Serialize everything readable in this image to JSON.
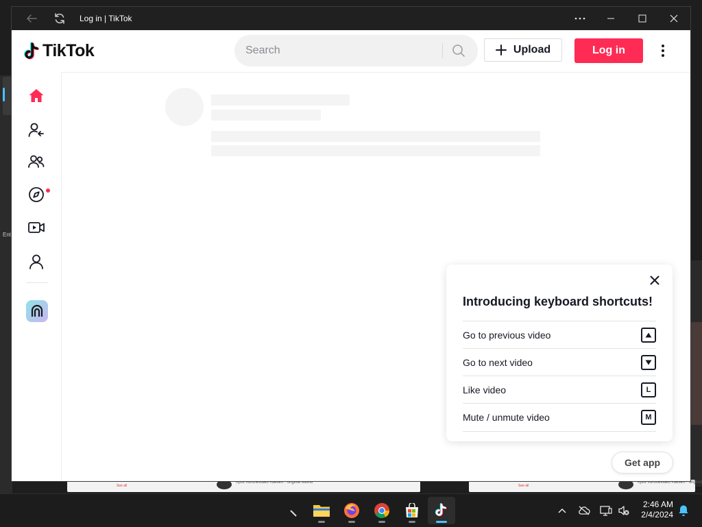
{
  "window": {
    "title": "Log in | TikTok"
  },
  "header": {
    "logo_text": "TikTok",
    "search_placeholder": "Search",
    "upload_label": "Upload",
    "login_label": "Log in"
  },
  "sidebar": {
    "items": [
      {
        "name": "home",
        "icon": "home-icon",
        "active": true
      },
      {
        "name": "following",
        "icon": "following-icon"
      },
      {
        "name": "friends",
        "icon": "friends-icon"
      },
      {
        "name": "explore",
        "icon": "compass-icon",
        "has_notification": true
      },
      {
        "name": "live",
        "icon": "live-video-icon"
      },
      {
        "name": "profile",
        "icon": "profile-icon"
      }
    ]
  },
  "shortcuts_popup": {
    "title": "Introducing keyboard shortcuts!",
    "items": [
      {
        "label": "Go to previous video",
        "key": "▲"
      },
      {
        "label": "Go to next video",
        "key": "▼"
      },
      {
        "label": "Like video",
        "key": "L"
      },
      {
        "label": "Mute / unmute video",
        "key": "M"
      }
    ]
  },
  "get_app_label": "Get app",
  "desktop": {
    "left_edge_text": "Ent"
  },
  "taskbar": {
    "time": "2:46 AM",
    "date": "2/4/2024"
  },
  "colors": {
    "brand": "#fe2c55",
    "titlebar": "#202020",
    "taskbar": "#1c1c1c",
    "accent": "#4cc2ff"
  }
}
